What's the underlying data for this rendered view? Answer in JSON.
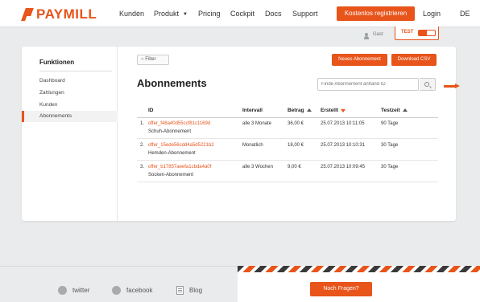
{
  "brand": {
    "name": "PAYMILL",
    "accent": "#e8541a"
  },
  "nav": {
    "items": [
      "Kunden",
      "Produkt",
      "Pricing",
      "Cockpit",
      "Docs",
      "Support"
    ],
    "register_label": "Kostenlos registrieren",
    "login_label": "Login",
    "language": "DE"
  },
  "subheader": {
    "guest_label": "Gast",
    "test_label": "TEST"
  },
  "sidebar": {
    "title": "Funktionen",
    "items": [
      {
        "label": "Dashboard",
        "active": false
      },
      {
        "label": "Zahlungen",
        "active": false
      },
      {
        "label": "Kunden",
        "active": false
      },
      {
        "label": "Abonnements",
        "active": true
      }
    ]
  },
  "main": {
    "filter_label": "Filter",
    "new_subscription_label": "Neues Abonnement",
    "download_csv_label": "Download CSV",
    "title": "Abonnements",
    "search_placeholder": "Finde Abonnement anhand ID"
  },
  "table": {
    "headers": [
      "ID",
      "Intervall",
      "Betrag",
      "Erstellt",
      "Testzeit"
    ],
    "rows": [
      {
        "num": "1.",
        "id": "offer_f48a40d55ccf81c1169d",
        "name": "Schuh-Abonnement",
        "interval": "alle 3 Monate",
        "amount": "36,00 €",
        "created": "25.07.2013 10:11:05",
        "trial": "90 Tage"
      },
      {
        "num": "2.",
        "id": "offer_15ede56cdd4a5d5221b2",
        "name": "Hemden-Abonnement",
        "interval": "Monatlich",
        "amount": "18,00 €",
        "created": "25.07.2013 10:10:31",
        "trial": "30 Tage"
      },
      {
        "num": "3.",
        "id": "offer_b17857aeefa1cbda4a0f",
        "name": "Socken-Abonnement",
        "interval": "alle 3 Wochen",
        "amount": "9,00 €",
        "created": "25.07.2013 10:09:45",
        "trial": "30 Tage"
      }
    ]
  },
  "footer": {
    "twitter_label": "twitter",
    "facebook_label": "facebook",
    "blog_label": "Blog",
    "questions_label": "Noch Fragen?"
  }
}
